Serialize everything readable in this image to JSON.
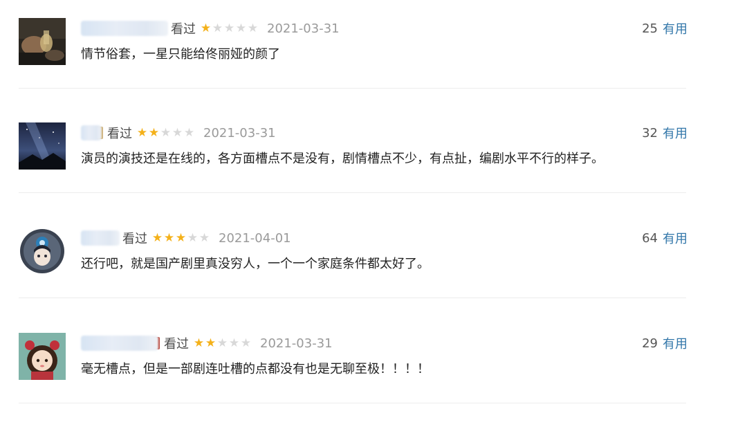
{
  "reviews": [
    {
      "status": "看过",
      "rating": 1,
      "max_rating": 5,
      "date": "2021-03-31",
      "votes": "25",
      "useful_label": "有用",
      "comment": "情节俗套，一星只能给佟丽娅的颜了",
      "avatar_icon": "user-photo-icon"
    },
    {
      "status": "看过",
      "rating": 2,
      "max_rating": 5,
      "date": "2021-03-31",
      "votes": "32",
      "useful_label": "有用",
      "comment": "演员的演技还是在线的，各方面槽点不是没有，剧情槽点不少，有点扯，编剧水平不行的样子。",
      "avatar_icon": "starry-sky-avatar-icon"
    },
    {
      "status": "看过",
      "rating": 3,
      "max_rating": 5,
      "date": "2021-04-01",
      "votes": "64",
      "useful_label": "有用",
      "comment": "还行吧，就是国产剧里真没穷人，一个一个家庭条件都太好了。",
      "avatar_icon": "anime-girl-avatar-icon"
    },
    {
      "status": "看过",
      "rating": 2,
      "max_rating": 5,
      "date": "2021-03-31",
      "votes": "29",
      "useful_label": "有用",
      "comment": "毫无槽点，但是一部剧连吐槽的点都没有也是无聊至极！！！！",
      "avatar_icon": "cartoon-girl-avatar-icon"
    }
  ],
  "colors": {
    "star_on": "#f4b11a",
    "star_off": "#d8d8d8",
    "useful_link": "#3377aa",
    "date": "#9a9a9a"
  }
}
